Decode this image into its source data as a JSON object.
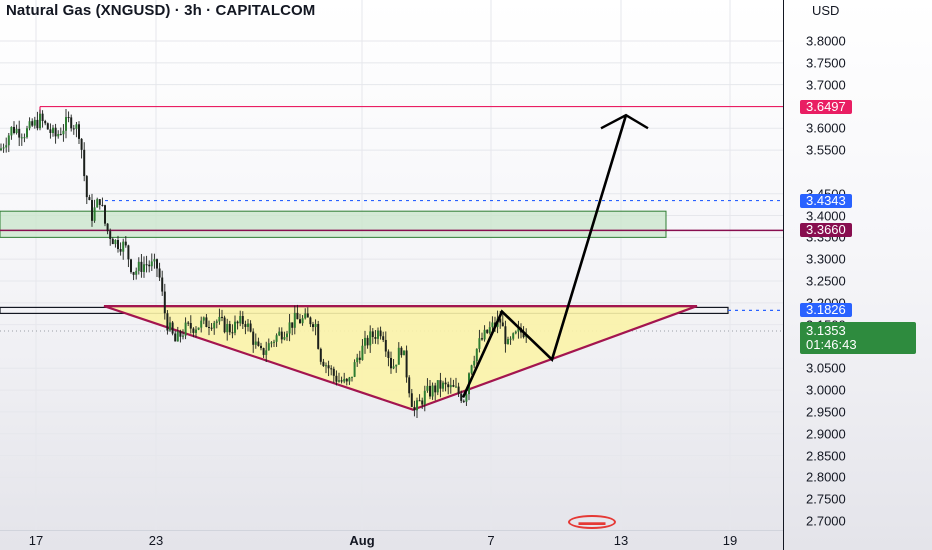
{
  "header": {
    "title": "Natural Gas (XNGUSD) · 3h · CAPITALCOM",
    "currency": "USD"
  },
  "price_axis": {
    "ticks": [
      "3.8000",
      "3.7500",
      "3.7000",
      "3.6000",
      "3.5500",
      "3.4500",
      "3.4000",
      "3.3500",
      "3.3000",
      "3.2500",
      "3.2000",
      "3.1500",
      "3.0500",
      "3.0000",
      "2.9500",
      "2.9000",
      "2.8500",
      "2.8000",
      "2.7500",
      "2.7000"
    ],
    "badges": [
      {
        "id": "resistance",
        "label": "3.6497",
        "color": "#e91e63",
        "price": 3.6497
      },
      {
        "id": "dotted-blue",
        "label": "3.4343",
        "color": "#2962ff",
        "price": 3.4343
      },
      {
        "id": "zone",
        "label": "3.3660",
        "color": "#880e4f",
        "price": 3.366
      },
      {
        "id": "neckline",
        "label": "3.1826",
        "color": "#2962ff",
        "price": 3.1826
      }
    ],
    "last_price": {
      "value": "3.1353",
      "countdown": "01:46:43",
      "color": "#2e8b3e"
    }
  },
  "time_axis": {
    "labels": [
      {
        "text": "17",
        "bold": false
      },
      {
        "text": "23",
        "bold": false
      },
      {
        "text": "Aug",
        "bold": true
      },
      {
        "text": "7",
        "bold": false
      },
      {
        "text": "13",
        "bold": false
      },
      {
        "text": "19",
        "bold": false
      }
    ]
  },
  "drawings": {
    "pattern_fill": "#fbf3a8",
    "pattern_stroke": "#a3154f",
    "zone_fill": "#c8e6c9",
    "projection_color": "#000000",
    "candle_color": "#2e7d32"
  },
  "icons": {
    "events": "us-flag-icon"
  }
}
